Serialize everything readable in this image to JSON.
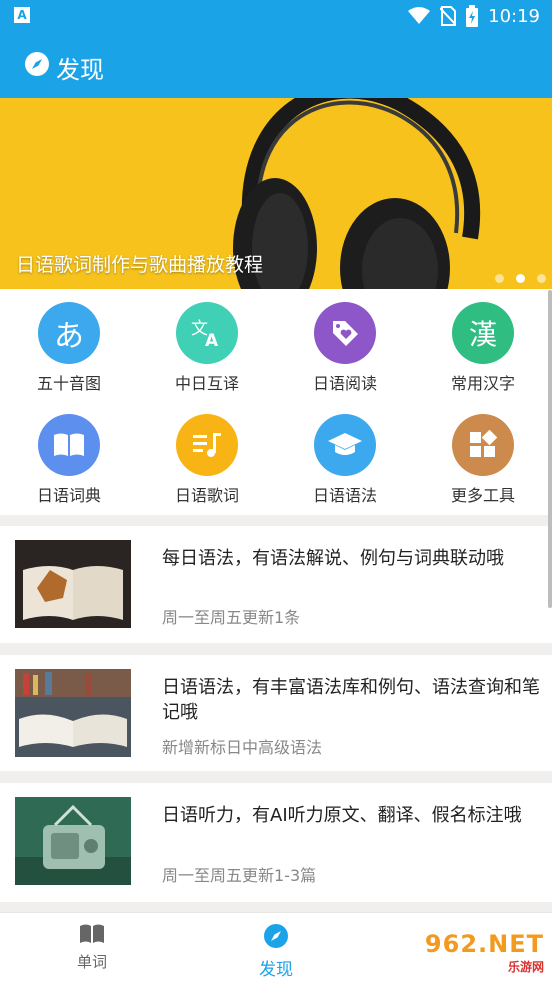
{
  "status": {
    "time": "10:19",
    "app_badge": "A"
  },
  "header": {
    "title": "发现"
  },
  "banner": {
    "caption": "日语歌词制作与歌曲播放教程",
    "dots": 3,
    "active_dot": 1
  },
  "tools": [
    {
      "label": "五十音图",
      "glyph": "あ",
      "color": "#3ca9ee"
    },
    {
      "label": "中日互译",
      "glyph": "translate-icon",
      "color": "#3fd0b5"
    },
    {
      "label": "日语阅读",
      "glyph": "tag-heart-icon",
      "color": "#8e57c9"
    },
    {
      "label": "常用汉字",
      "glyph": "漢",
      "color": "#2fbd82"
    },
    {
      "label": "日语词典",
      "glyph": "book-icon",
      "color": "#5c8fee"
    },
    {
      "label": "日语歌词",
      "glyph": "music-list-icon",
      "color": "#f7b414"
    },
    {
      "label": "日语语法",
      "glyph": "graduation-cap-icon",
      "color": "#3ca9ee"
    },
    {
      "label": "更多工具",
      "glyph": "apps-icon",
      "color": "#cc8a4c"
    }
  ],
  "cards": [
    {
      "title": "每日语法，有语法解说、例句与词典联动哦",
      "subtitle": "周一至周五更新1条"
    },
    {
      "title": "日语语法，有丰富语法库和例句、语法查询和笔记哦",
      "subtitle": "新增新标日中高级语法"
    },
    {
      "title": "日语听力，有AI听力原文、翻译、假名标注哦",
      "subtitle": "周一至周五更新1-3篇"
    }
  ],
  "tabs": [
    {
      "label": "单词",
      "icon": "book-icon"
    },
    {
      "label": "发现",
      "icon": "compass-icon"
    }
  ],
  "watermark": {
    "main": "962.NET",
    "sub": "乐游网"
  }
}
